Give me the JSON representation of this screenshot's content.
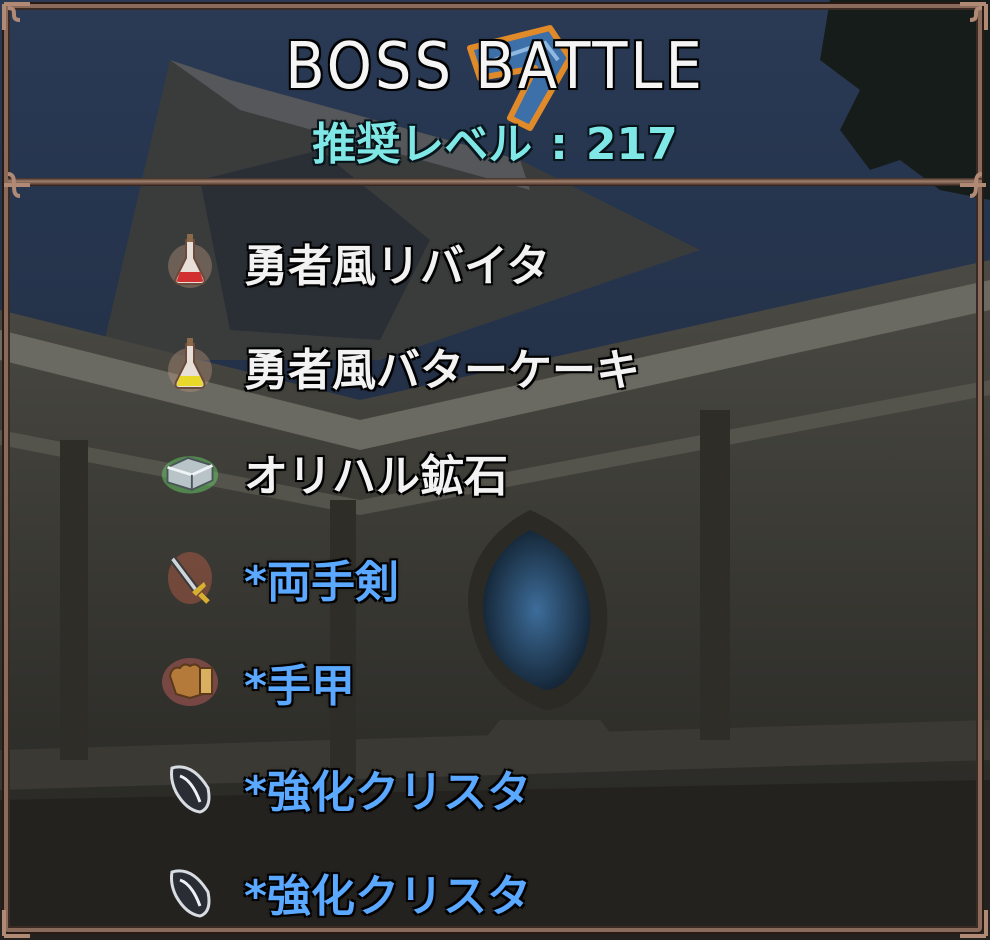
{
  "header": {
    "title": "BOSS BATTLE",
    "level_label": "推奨レベル",
    "level_sep": ":",
    "level_value": "217"
  },
  "rewards": [
    {
      "icon": "red-potion-icon",
      "label": "勇者風リバイタ",
      "color": "white"
    },
    {
      "icon": "yellow-potion-icon",
      "label": "勇者風バターケーキ",
      "color": "white"
    },
    {
      "icon": "ore-ingot-icon",
      "label": "オリハル鉱石",
      "color": "white"
    },
    {
      "icon": "sword-icon",
      "label": "*両手剣",
      "color": "blue"
    },
    {
      "icon": "gauntlet-icon",
      "label": "*手甲",
      "color": "blue"
    },
    {
      "icon": "crystal-icon",
      "label": "*強化クリスタ",
      "color": "blue"
    },
    {
      "icon": "crystal-icon",
      "label": "*強化クリスタ",
      "color": "blue"
    }
  ],
  "colors": {
    "label_white": "#f2f2f2",
    "label_blue": "#5aa8ff",
    "level_cyan": "#7fe7e6",
    "frame_bronze": "#8a6a5a"
  }
}
